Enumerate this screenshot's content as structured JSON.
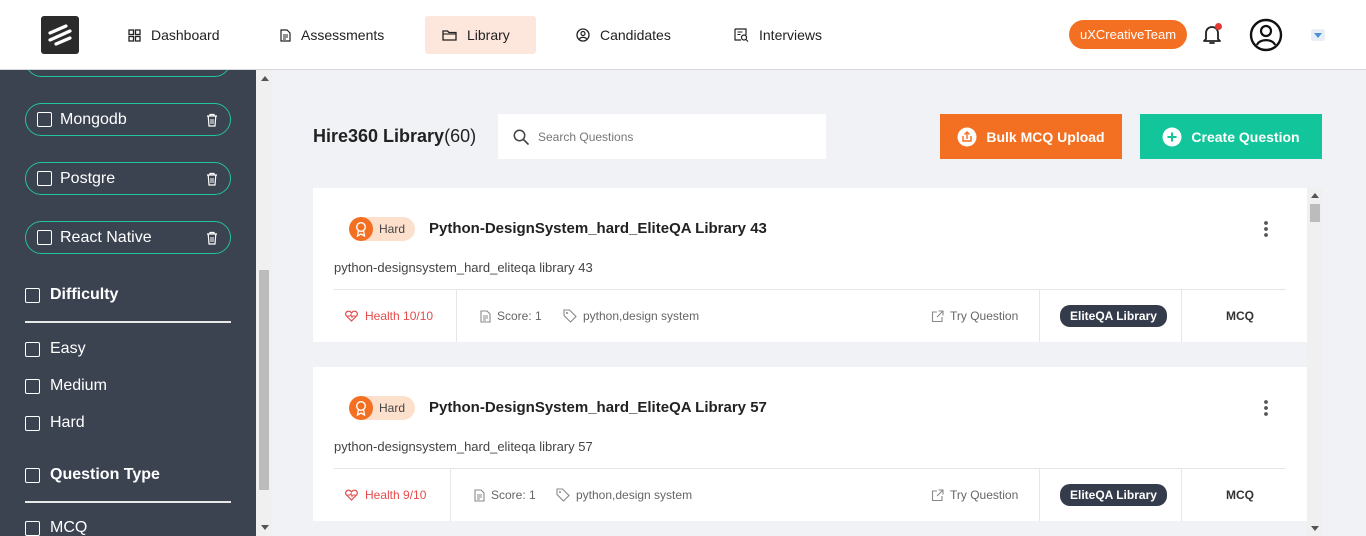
{
  "nav": {
    "items": [
      {
        "label": "Dashboard",
        "icon": "grid-icon",
        "active": false
      },
      {
        "label": "Assessments",
        "icon": "document-icon",
        "active": false
      },
      {
        "label": "Library",
        "icon": "folder-icon",
        "active": true
      },
      {
        "label": "Candidates",
        "icon": "user-circle-icon",
        "active": false
      },
      {
        "label": "Interviews",
        "icon": "interview-icon",
        "active": false
      }
    ],
    "team": "uXCreativeTeam",
    "accent_color": "#f36f21"
  },
  "sidebar": {
    "tags": [
      {
        "label": "Mongodb"
      },
      {
        "label": "Postgre"
      },
      {
        "label": "React Native"
      }
    ],
    "difficulty": {
      "heading": "Difficulty",
      "options": [
        "Easy",
        "Medium",
        "Hard"
      ]
    },
    "question_type": {
      "heading": "Question Type",
      "options": [
        "MCQ"
      ]
    }
  },
  "library": {
    "title": "Hire360 Library",
    "count": "(60)",
    "search_placeholder": "Search Questions",
    "bulk_button": "Bulk MCQ Upload",
    "create_button": "Create Question"
  },
  "questions": [
    {
      "difficulty": "Hard",
      "title": "Python-DesignSystem_hard_EliteQA Library 43",
      "description": "python-designsystem_hard_eliteqa library 43",
      "health": "Health 10/10",
      "score": "Score: 1",
      "tags": "python,design system",
      "try_label": "Try Question",
      "library": "EliteQA Library",
      "type": "MCQ"
    },
    {
      "difficulty": "Hard",
      "title": "Python-DesignSystem_hard_EliteQA Library 57",
      "description": "python-designsystem_hard_eliteqa library 57",
      "health": "Health 9/10",
      "score": "Score: 1",
      "tags": "python,design system",
      "try_label": "Try Question",
      "library": "EliteQA Library",
      "type": "MCQ"
    }
  ]
}
